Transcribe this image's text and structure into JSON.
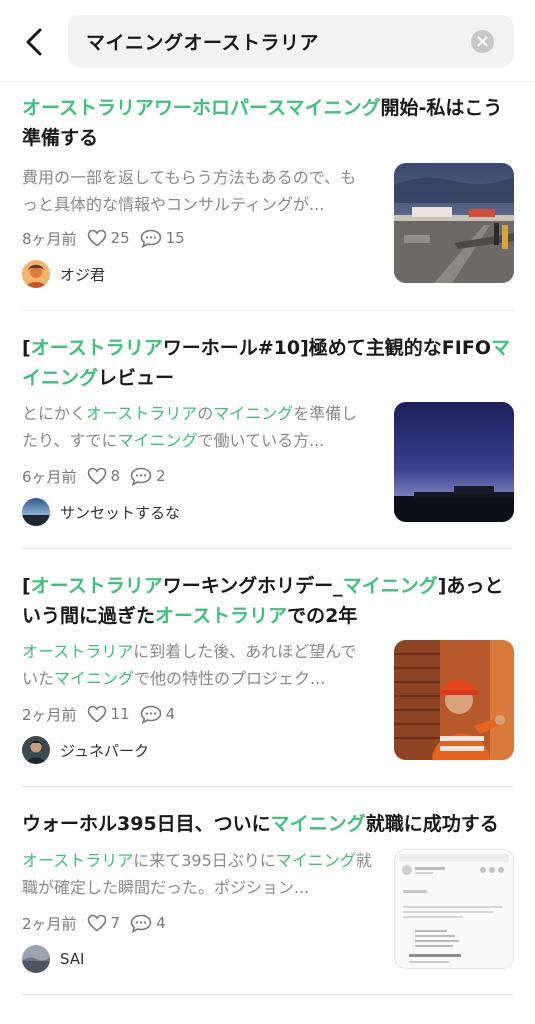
{
  "search": {
    "query": "マイニングオーストラリア"
  },
  "colors": {
    "highlight": "#3ec17a",
    "meta": "#7a7a7a",
    "excerpt": "#8a8a8a"
  },
  "articles": [
    {
      "title": [
        {
          "t": "オーストラリアワーホロパースマイニング",
          "hl": true
        },
        {
          "t": "開始-私はこう準備する",
          "hl": false
        }
      ],
      "excerpt": [
        {
          "t": "費用の一部を返してもらう方法もあるので、もっと具体的な情報やコンサルティングが...",
          "hl": false
        }
      ],
      "date": "8ヶ月前",
      "likes": "25",
      "comments": "15",
      "author": "オジ君",
      "avatar_icon": "person-avatar-icon",
      "thumbnail_icon": "airport-tarmac-photo"
    },
    {
      "title": [
        {
          "t": "[",
          "hl": false
        },
        {
          "t": "オーストラリア",
          "hl": true
        },
        {
          "t": "ワーホール#10]極めて主観的なFIFO",
          "hl": false
        },
        {
          "t": "マイニング",
          "hl": true
        },
        {
          "t": "レビュー",
          "hl": false
        }
      ],
      "excerpt": [
        {
          "t": "とにかく",
          "hl": false
        },
        {
          "t": "オーストラリア",
          "hl": true
        },
        {
          "t": "の",
          "hl": false
        },
        {
          "t": "マイニング",
          "hl": true
        },
        {
          "t": "を準備したり、すでに",
          "hl": false
        },
        {
          "t": "マイニング",
          "hl": true
        },
        {
          "t": "で働いている方...",
          "hl": false
        }
      ],
      "date": "6ヶ月前",
      "likes": "8",
      "comments": "2",
      "author": "サンセットするな",
      "avatar_icon": "sunset-avatar-icon",
      "thumbnail_icon": "twilight-sky-photo"
    },
    {
      "title": [
        {
          "t": "[",
          "hl": false
        },
        {
          "t": "オーストラリア",
          "hl": true
        },
        {
          "t": "ワーキングホリデー_",
          "hl": false
        },
        {
          "t": "マイニング",
          "hl": true
        },
        {
          "t": "]あっという間に過ぎた",
          "hl": false
        },
        {
          "t": "オーストラリア",
          "hl": true
        },
        {
          "t": "での2年",
          "hl": false
        }
      ],
      "excerpt": [
        {
          "t": "オーストラリア",
          "hl": true
        },
        {
          "t": "に到着した後、あれほど望んでいた",
          "hl": false
        },
        {
          "t": "マイニング",
          "hl": true
        },
        {
          "t": "で他の特性のプロジェク...",
          "hl": false
        }
      ],
      "date": "2ヶ月前",
      "likes": "11",
      "comments": "4",
      "author": "ジュネパーク",
      "avatar_icon": "portrait-avatar-icon",
      "thumbnail_icon": "mining-worker-photo"
    },
    {
      "title": [
        {
          "t": "ウォーホル395日目、ついに",
          "hl": false
        },
        {
          "t": "マイニング",
          "hl": true
        },
        {
          "t": "就職に成功する",
          "hl": false
        }
      ],
      "excerpt": [
        {
          "t": "オーストラリア",
          "hl": true
        },
        {
          "t": "に来て395日ぶりに",
          "hl": false
        },
        {
          "t": "マイニング",
          "hl": true
        },
        {
          "t": "就職が確定した瞬間だった。ポジション...",
          "hl": false
        }
      ],
      "date": "2ヶ月前",
      "likes": "7",
      "comments": "4",
      "author": "SAI",
      "avatar_icon": "landscape-avatar-icon",
      "thumbnail_icon": "email-screenshot-photo"
    }
  ]
}
